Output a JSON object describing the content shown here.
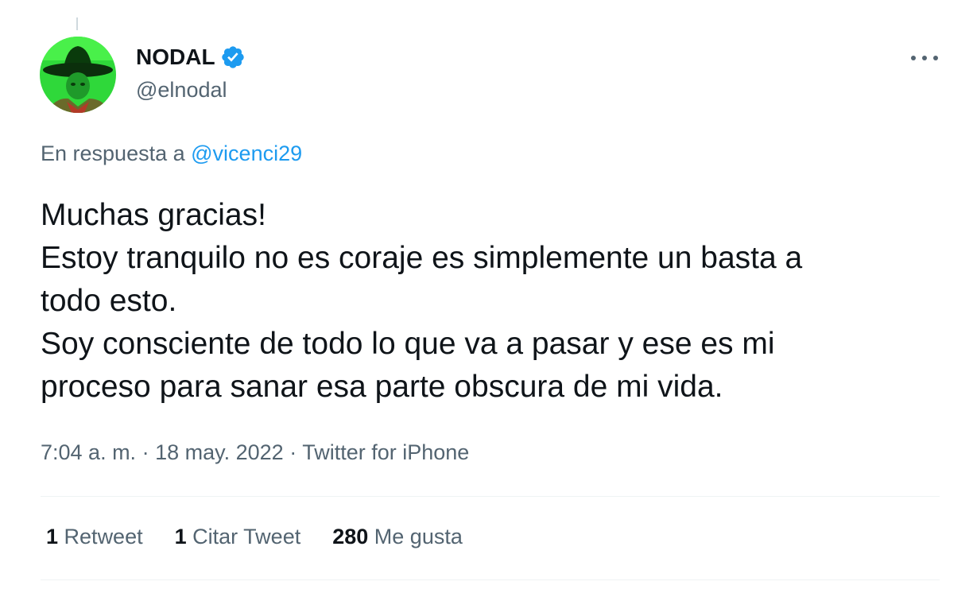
{
  "author": {
    "display_name": "NODAL",
    "handle": "@elnodal",
    "verified_icon": "verified-badge-icon",
    "verified_color": "#1d9bf0"
  },
  "reply": {
    "prefix": "En respuesta a",
    "mention": "@vicenci29"
  },
  "tweet": {
    "lines": [
      "Muchas gracias!",
      "Estoy tranquilo no es coraje es simplemente un basta a",
      "todo esto.",
      "Soy consciente de todo lo que va a pasar y ese es mi",
      "proceso para sanar esa parte obscura de mi vida."
    ]
  },
  "meta": {
    "time": "7:04 a. m.",
    "separator": " · ",
    "date": "18 may. 2022",
    "source": "Twitter for iPhone"
  },
  "stats": {
    "retweets": {
      "count": "1",
      "label": "Retweet"
    },
    "quotes": {
      "count": "1",
      "label": "Citar Tweet"
    },
    "likes": {
      "count": "280",
      "label": "Me gusta"
    }
  },
  "icons": {
    "more": "more-options-icon"
  },
  "colors": {
    "text_primary": "#0f1419",
    "text_secondary": "#536471",
    "accent": "#1d9bf0",
    "divider": "#eff3f4"
  }
}
